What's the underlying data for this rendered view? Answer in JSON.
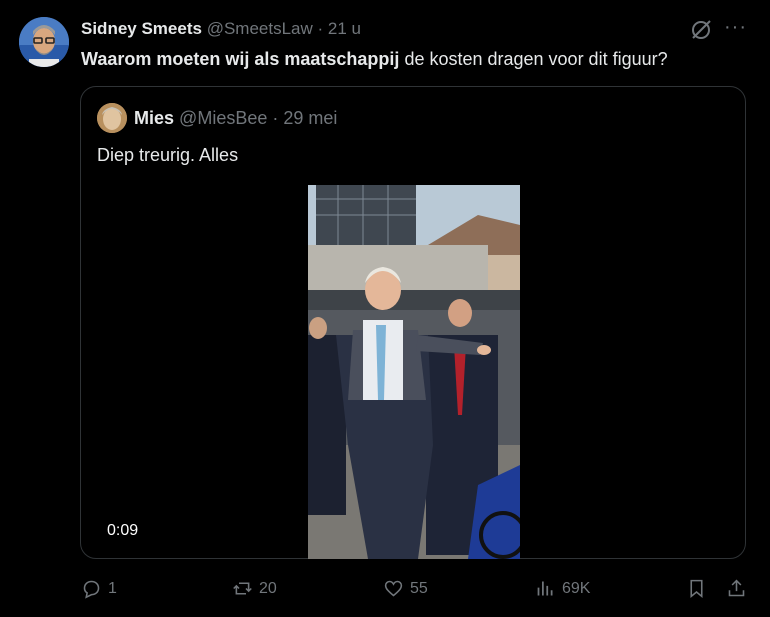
{
  "tweet": {
    "author_name": "Sidney Smeets",
    "handle": "@SmeetsLaw",
    "separator": "·",
    "time": "21 u",
    "text_bold": "Waarom moeten wij als maatschappij",
    "text_rest": " de kosten dragen voor dit figuur?",
    "more_label": "···"
  },
  "quote": {
    "author_name": "Mies",
    "handle": "@MiesBee",
    "separator": "·",
    "time": "29 mei",
    "text": "Diep treurig. Alles",
    "video_time": "0:09"
  },
  "actions": {
    "replies": "1",
    "reposts": "20",
    "likes": "55",
    "views": "69K"
  },
  "colors": {
    "background": "#000000",
    "text": "#e7e9ea",
    "muted": "#71767b",
    "border": "#2f3336"
  }
}
